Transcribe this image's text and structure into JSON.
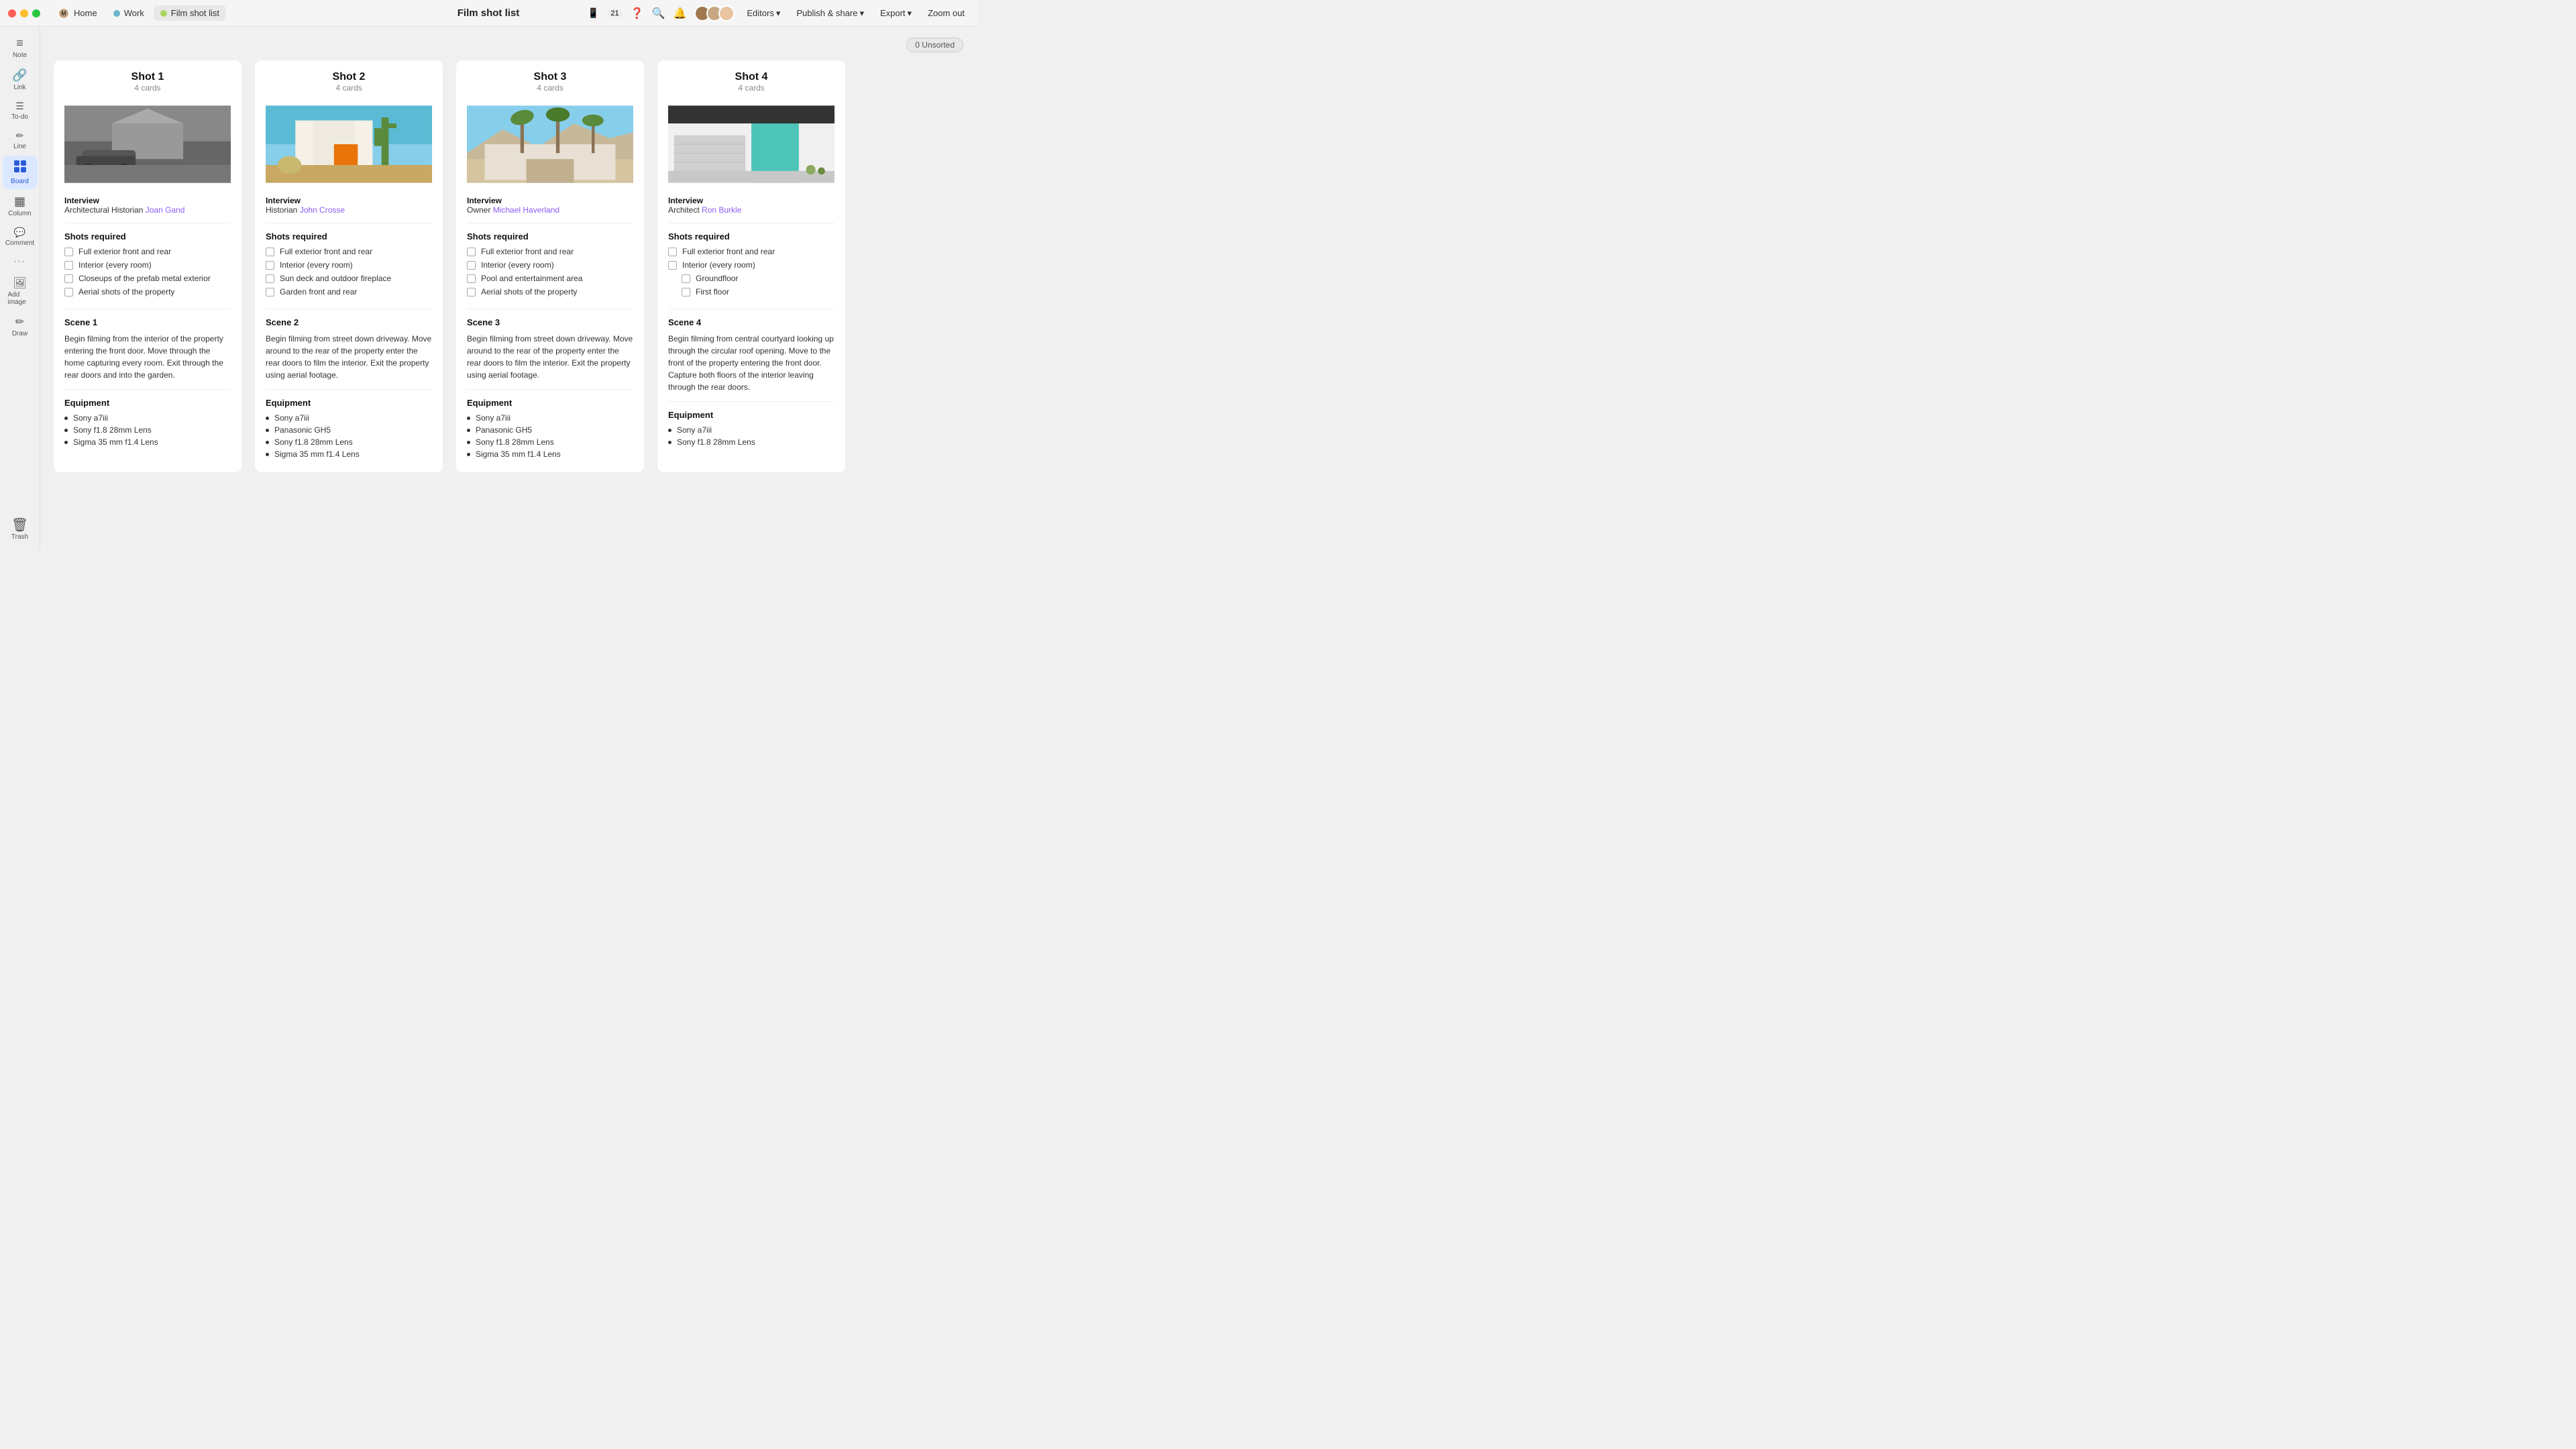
{
  "titlebar": {
    "traffic_lights": [
      "red",
      "yellow",
      "green"
    ],
    "nav_tabs": [
      {
        "label": "Home",
        "type": "home"
      },
      {
        "label": "Work",
        "type": "work",
        "color": "#6bb5c8"
      },
      {
        "label": "Film shot list",
        "type": "film",
        "color": "#a8d660"
      }
    ],
    "page_title": "Film shot list",
    "notification_badge": "21",
    "editors_label": "Editors",
    "publish_label": "Publish & share",
    "export_label": "Export",
    "zoom_label": "Zoom out"
  },
  "sidebar": {
    "items": [
      {
        "id": "note",
        "label": "Note",
        "icon": "≡"
      },
      {
        "id": "link",
        "label": "Link",
        "icon": "🔗"
      },
      {
        "id": "todo",
        "label": "To-do",
        "icon": "☰"
      },
      {
        "id": "line",
        "label": "Line",
        "icon": "✏"
      },
      {
        "id": "board",
        "label": "Board",
        "icon": "⊞",
        "active": true
      },
      {
        "id": "column",
        "label": "Column",
        "icon": "▦"
      },
      {
        "id": "comment",
        "label": "Comment",
        "icon": "💬"
      },
      {
        "id": "more",
        "label": "",
        "icon": "···"
      },
      {
        "id": "add-image",
        "label": "Add image",
        "icon": "🖼"
      },
      {
        "id": "draw",
        "label": "Draw",
        "icon": "🖊"
      }
    ],
    "trash_label": "Trash"
  },
  "board": {
    "unsorted_label": "0 Unsorted",
    "columns": [
      {
        "id": "shot1",
        "title": "Shot 1",
        "card_count": "4 cards",
        "image_type": "bw",
        "interview_role": "Interview",
        "interview_subtitle": "Architectural Historian",
        "interview_name": "Joan Gand",
        "shots_title": "Shots required",
        "shots": [
          "Full exterior front and rear",
          "Interior (every room)",
          "Closeups of the prefab metal exterior",
          "Aerial shots of the property"
        ],
        "scene_title": "Scene 1",
        "scene_text": "Begin filming from the interior of the property entering the front door. Move through the home capturing every room. Exit through the rear doors and into the garden.",
        "equipment_title": "Equipment",
        "equipment": [
          "Sony a7iii",
          "Sony f1.8 28mm Lens",
          "Sigma 35 mm f1.4 Lens"
        ]
      },
      {
        "id": "shot2",
        "title": "Shot 2",
        "card_count": "4 cards",
        "image_type": "colorful-orange",
        "interview_role": "Interview",
        "interview_subtitle": "Historian",
        "interview_name": "John Crosse",
        "shots_title": "Shots required",
        "shots": [
          "Full exterior front and rear",
          "Interior (every room)",
          "Sun deck and outdoor fireplace",
          "Garden front and rear"
        ],
        "scene_title": "Scene 2",
        "scene_text": "Begin filming from street down driveway. Move around to the rear of the property enter the rear doors to film the interior. Exit the property using aerial footage.",
        "equipment_title": "Equipment",
        "equipment": [
          "Sony a7iii",
          "Panasonic GH5",
          "Sony f1.8 28mm Lens",
          "Sigma 35 mm f1.4 Lens"
        ]
      },
      {
        "id": "shot3",
        "title": "Shot 3",
        "card_count": "4 cards",
        "image_type": "palm-trees",
        "interview_role": "Interview",
        "interview_subtitle": "Owner",
        "interview_name": "Michael Haverland",
        "shots_title": "Shots required",
        "shots": [
          "Full exterior front and rear",
          "Interior (every room)",
          "Pool and entertainment area",
          "Aerial shots of the property"
        ],
        "scene_title": "Scene 3",
        "scene_text": "Begin filming from street down driveway. Move around to the rear of the property enter the rear doors to film the interior. Exit the property using aerial footage.",
        "equipment_title": "Equipment",
        "equipment": [
          "Sony a7iii",
          "Panasonic GH5",
          "Sony f1.8 28mm Lens",
          "Sigma 35 mm f1.4 Lens"
        ]
      },
      {
        "id": "shot4",
        "title": "Shot 4",
        "card_count": "4 cards",
        "image_type": "teal-garage",
        "interview_role": "Interview",
        "interview_subtitle": "Architect",
        "interview_name": "Ron Burkle",
        "shots_title": "Shots required",
        "shots": [
          "Full exterior front and rear",
          "Interior (every room)"
        ],
        "sub_shots": [
          "Groundfloor",
          "First floor"
        ],
        "scene_title": "Scene 4",
        "scene_text": "Begin filming from central courtyard looking up through the circular roof opening. Move to the front of the property entering the front door. Capture both floors of the interior leaving through the rear doors.",
        "equipment_title": "Equipment",
        "equipment": [
          "Sony a7iii",
          "Sony f1.8 28mm Lens"
        ]
      }
    ]
  }
}
